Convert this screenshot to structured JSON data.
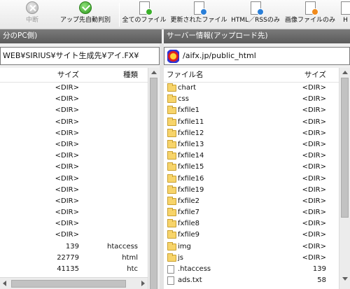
{
  "toolbar": {
    "items": [
      {
        "label": "中断",
        "icon": "stop-icon",
        "disabled": true
      },
      {
        "label": "アップ先自動判別",
        "icon": "check-icon"
      },
      {
        "label": "全てのファイル",
        "icon": "all-files-icon"
      },
      {
        "label": "更新されたファイル",
        "icon": "updated-files-icon"
      },
      {
        "label": "HTML／RSSのみ",
        "icon": "html-rss-icon"
      },
      {
        "label": "画像ファイルのみ",
        "icon": "image-files-icon"
      },
      {
        "label": "H"
      }
    ]
  },
  "left_panel": {
    "title": "分のPC側)",
    "path": "WEB¥SIRIUS¥サイト生成先¥アイ.FX¥",
    "columns": {
      "size": "サイズ",
      "type": "種類"
    },
    "rows": [
      {
        "size": "<DIR>",
        "type": ""
      },
      {
        "size": "<DIR>",
        "type": ""
      },
      {
        "size": "<DIR>",
        "type": ""
      },
      {
        "size": "<DIR>",
        "type": ""
      },
      {
        "size": "<DIR>",
        "type": ""
      },
      {
        "size": "<DIR>",
        "type": ""
      },
      {
        "size": "<DIR>",
        "type": ""
      },
      {
        "size": "<DIR>",
        "type": ""
      },
      {
        "size": "<DIR>",
        "type": ""
      },
      {
        "size": "<DIR>",
        "type": ""
      },
      {
        "size": "<DIR>",
        "type": ""
      },
      {
        "size": "<DIR>",
        "type": ""
      },
      {
        "size": "<DIR>",
        "type": ""
      },
      {
        "size": "<DIR>",
        "type": ""
      },
      {
        "size": "139",
        "type": "htaccess"
      },
      {
        "size": "22779",
        "type": "html"
      },
      {
        "size": "41135",
        "type": "htc"
      }
    ]
  },
  "right_panel": {
    "title": "サーバー情報(アップロード先)",
    "path": "/aifx.jp/public_html",
    "columns": {
      "name": "ファイル名",
      "size": "サイズ"
    },
    "rows": [
      {
        "name": "chart",
        "size": "<DIR>",
        "icon": "folder"
      },
      {
        "name": "css",
        "size": "<DIR>",
        "icon": "folder"
      },
      {
        "name": "fxfile1",
        "size": "<DIR>",
        "icon": "folder"
      },
      {
        "name": "fxfile11",
        "size": "<DIR>",
        "icon": "folder"
      },
      {
        "name": "fxfile12",
        "size": "<DIR>",
        "icon": "folder"
      },
      {
        "name": "fxfile13",
        "size": "<DIR>",
        "icon": "folder"
      },
      {
        "name": "fxfile14",
        "size": "<DIR>",
        "icon": "folder"
      },
      {
        "name": "fxfile15",
        "size": "<DIR>",
        "icon": "folder"
      },
      {
        "name": "fxfile16",
        "size": "<DIR>",
        "icon": "folder"
      },
      {
        "name": "fxfile19",
        "size": "<DIR>",
        "icon": "folder"
      },
      {
        "name": "fxfile2",
        "size": "<DIR>",
        "icon": "folder"
      },
      {
        "name": "fxfile7",
        "size": "<DIR>",
        "icon": "folder"
      },
      {
        "name": "fxfile8",
        "size": "<DIR>",
        "icon": "folder"
      },
      {
        "name": "fxfile9",
        "size": "<DIR>",
        "icon": "folder"
      },
      {
        "name": "img",
        "size": "<DIR>",
        "icon": "folder"
      },
      {
        "name": "js",
        "size": "<DIR>",
        "icon": "folder"
      },
      {
        "name": ".htaccess",
        "size": "139",
        "icon": "file"
      },
      {
        "name": "ads.txt",
        "size": "58",
        "icon": "file"
      }
    ]
  }
}
